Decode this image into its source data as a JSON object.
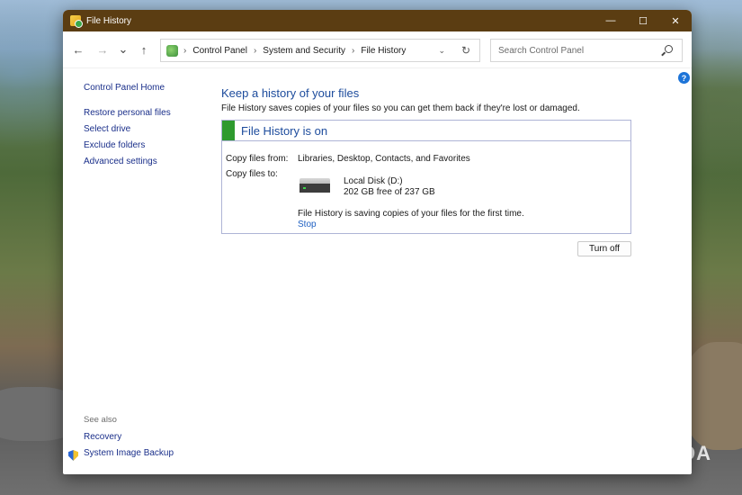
{
  "window": {
    "title": "File History"
  },
  "titlebar_controls": {
    "minimize": "—",
    "maximize": "☐",
    "close": "✕"
  },
  "nav": {
    "back": "←",
    "forward": "→",
    "recent": "⌄",
    "up": "↑"
  },
  "breadcrumb": [
    "Control Panel",
    "System and Security",
    "File History"
  ],
  "search": {
    "placeholder": "Search Control Panel"
  },
  "help": {
    "glyph": "?"
  },
  "sidebar": {
    "home": "Control Panel Home",
    "links": [
      "Restore personal files",
      "Select drive",
      "Exclude folders",
      "Advanced settings"
    ],
    "see_also_label": "See also",
    "see_also": [
      "Recovery",
      "System Image Backup"
    ]
  },
  "main": {
    "heading": "Keep a history of your files",
    "description": "File History saves copies of your files so you can get them back if they're lost or damaged.",
    "status_title": "File History is on",
    "copy_from_label": "Copy files from:",
    "copy_from_value": "Libraries, Desktop, Contacts, and Favorites",
    "copy_to_label": "Copy files to:",
    "drive_name": "Local Disk (D:)",
    "drive_space": "202 GB free of 237 GB",
    "progress_text": "File History is saving copies of your files for the first time.",
    "stop_link": "Stop",
    "turn_off_button": "Turn off"
  },
  "watermark": "XDA",
  "colors": {
    "titlebar": "#5b3d12",
    "link": "#1a2f8a",
    "heading": "#1c4b9c",
    "status_on": "#2e9a2e"
  }
}
